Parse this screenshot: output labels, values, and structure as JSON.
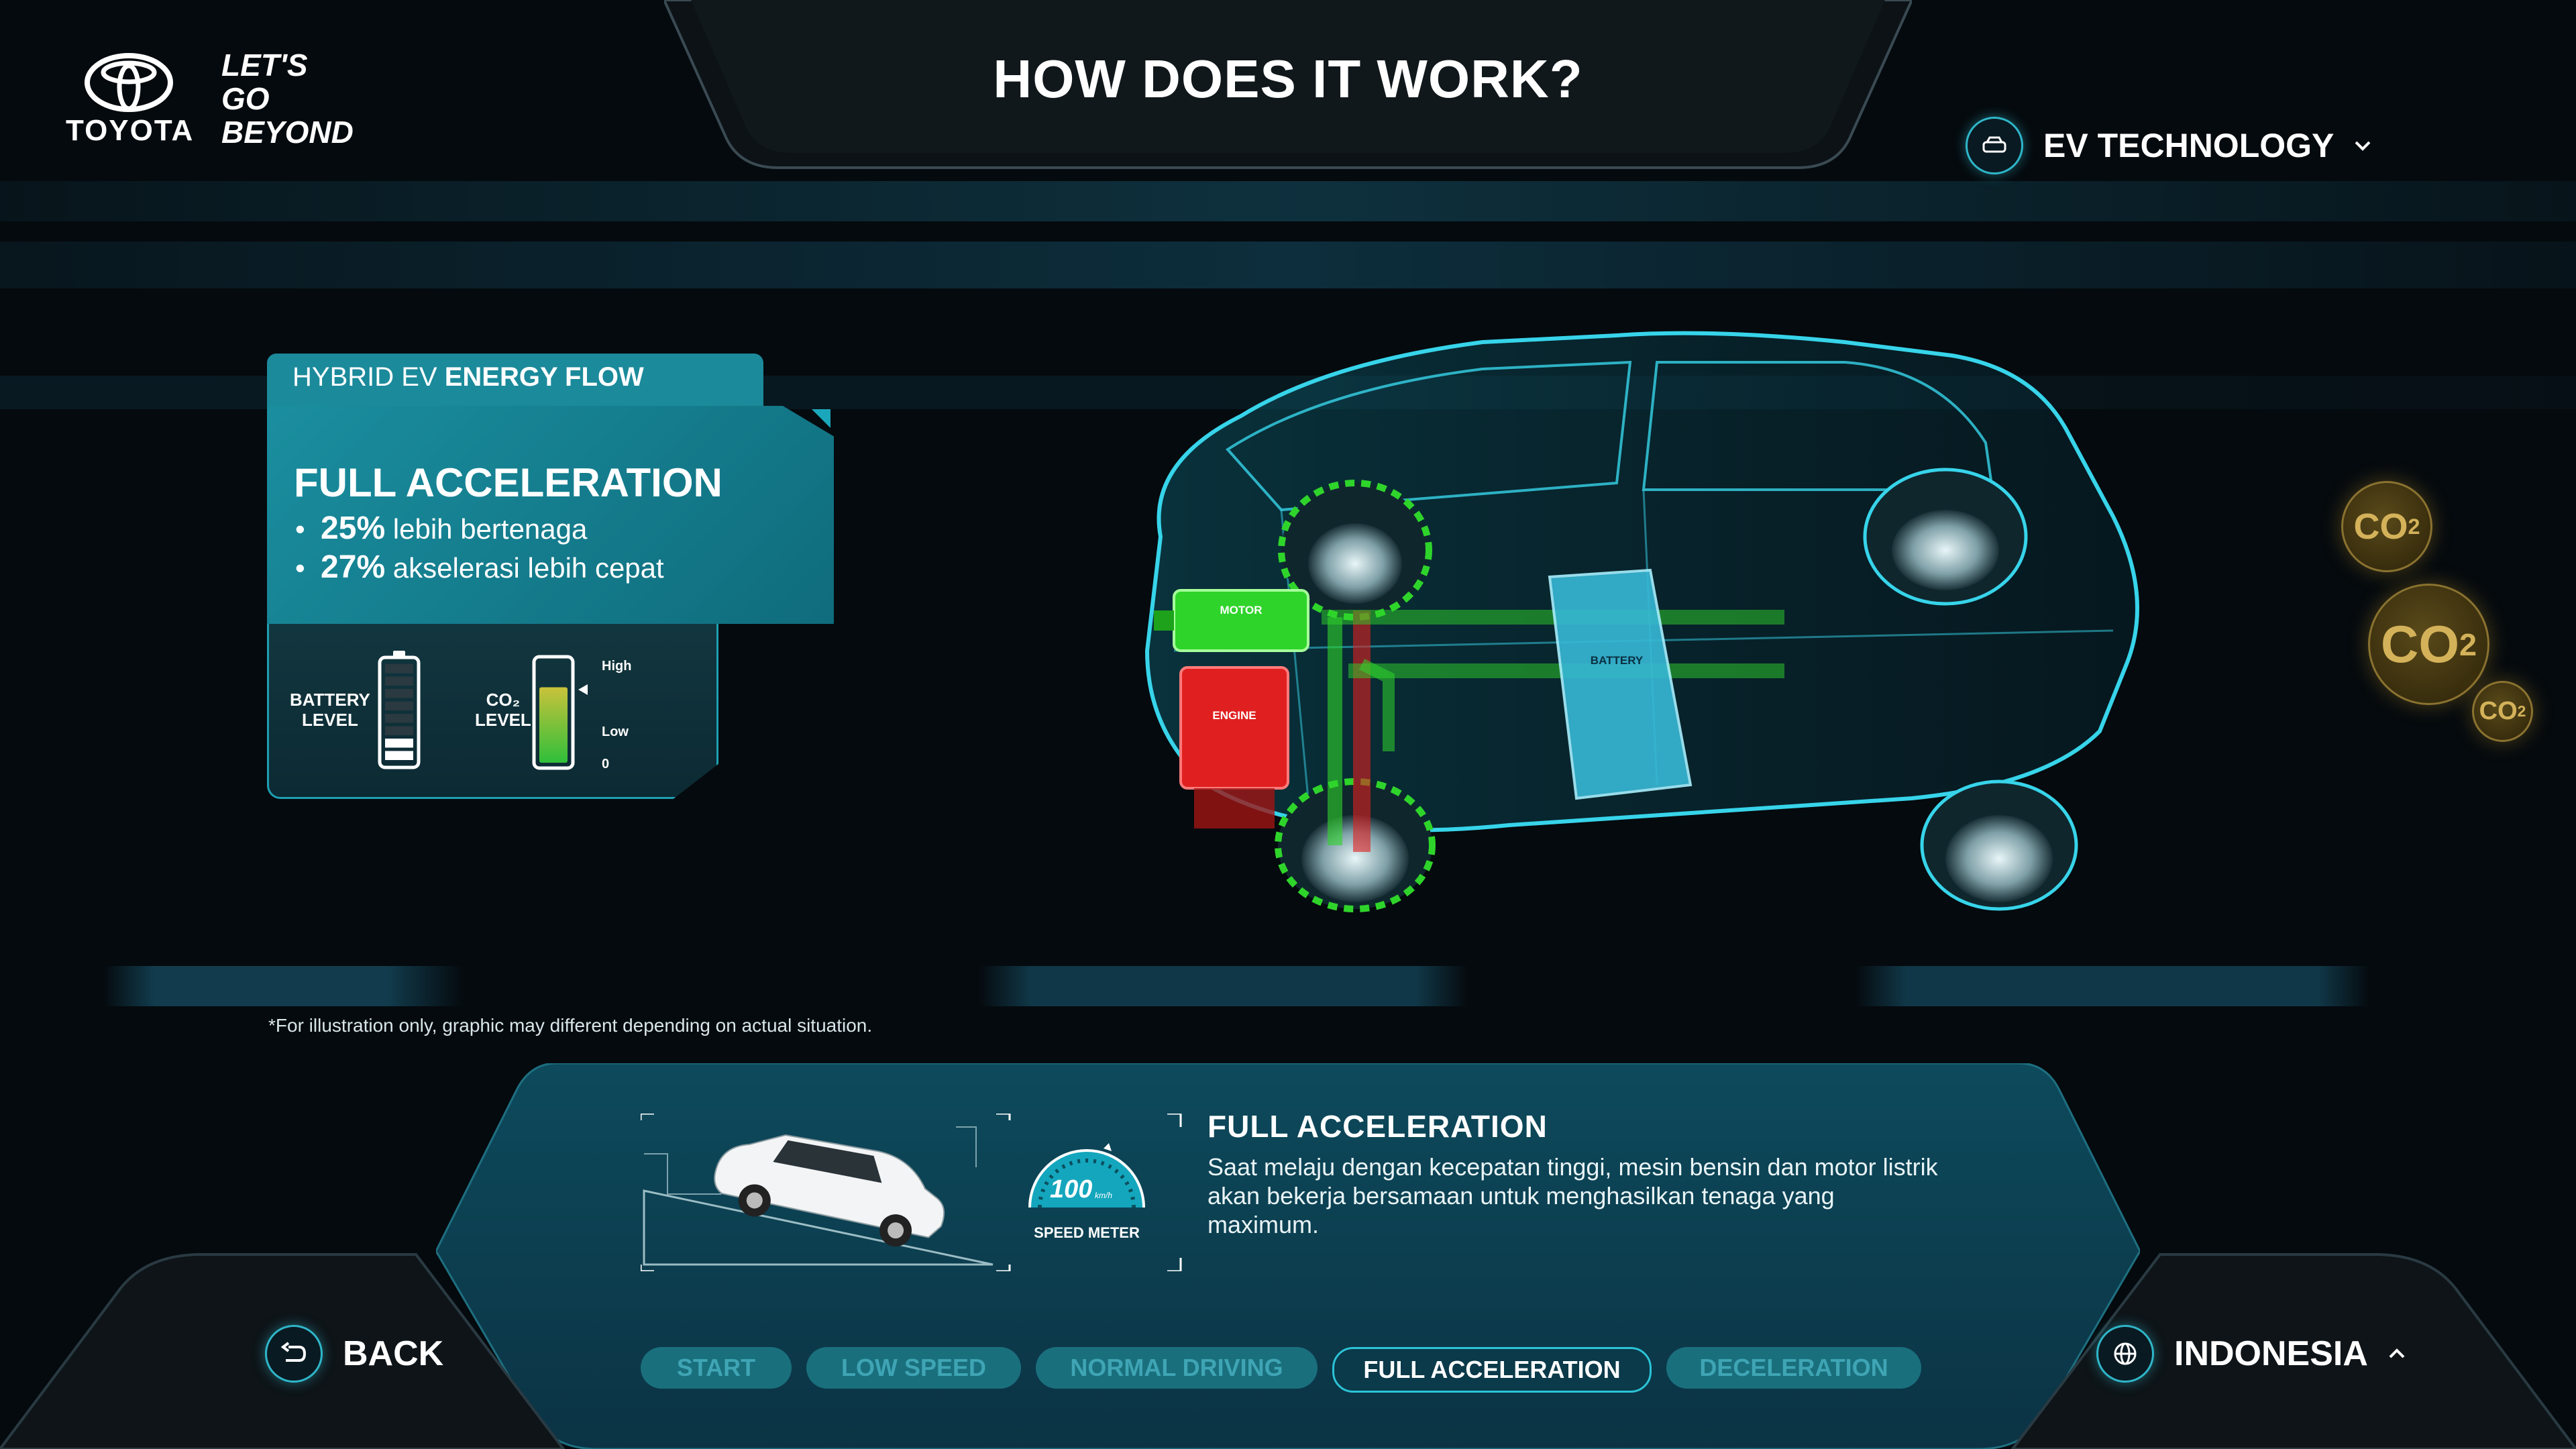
{
  "brand": {
    "name": "TOYOTA",
    "slogan_lines": [
      "LET'S",
      "GO",
      "BEYOND"
    ]
  },
  "header": {
    "title": "HOW DOES IT WORK?",
    "menu": {
      "label": "EV TECHNOLOGY",
      "icon": "car-icon",
      "chevron": "chevron-down-icon"
    }
  },
  "energy_panel": {
    "tab_prefix": "HYBRID EV ",
    "tab_bold": "ENERGY FLOW",
    "heading": "FULL ACCELERATION",
    "bullets": [
      {
        "value": "25%",
        "text": " lebih bertenaga"
      },
      {
        "value": "27%",
        "text": " akselerasi lebih cepat"
      }
    ],
    "battery_label_1": "BATTERY",
    "battery_label_2": "LEVEL",
    "co2_label_1": "CO₂",
    "co2_label_2": "LEVEL",
    "co2_high": "High",
    "co2_low": "Low",
    "co2_zero": "0",
    "battery_level_fraction": 0.25,
    "co2_level_fraction": 0.75
  },
  "diagram": {
    "motor_label": "MOTOR",
    "engine_label": "ENGINE",
    "battery_label": "BATTERY",
    "co2_bubbles": [
      "CO",
      "CO",
      "CO"
    ]
  },
  "disclaimer": "*For illustration only, graphic may different depending on actual situation.",
  "info": {
    "title": "FULL  ACCELERATION",
    "body": "Saat melaju dengan kecepatan tinggi, mesin bensin dan motor listrik akan bekerja bersamaan untuk menghasilkan tenaga yang maximum.",
    "speed_value": "100",
    "speed_unit": "km/h",
    "speed_label": "SPEED METER"
  },
  "nav": {
    "back_label": "BACK",
    "language_label": "INDONESIA",
    "steps": [
      "START",
      "LOW SPEED",
      "NORMAL DRIVING",
      "FULL ACCELERATION",
      "DECELERATION"
    ],
    "active_step": "FULL ACCELERATION"
  },
  "colors": {
    "accent": "#1e9fb2",
    "panel": "#1a8e9f",
    "motor_green": "#2fd42b",
    "engine_red": "#e02020",
    "co2_gold": "#d4b25a"
  }
}
